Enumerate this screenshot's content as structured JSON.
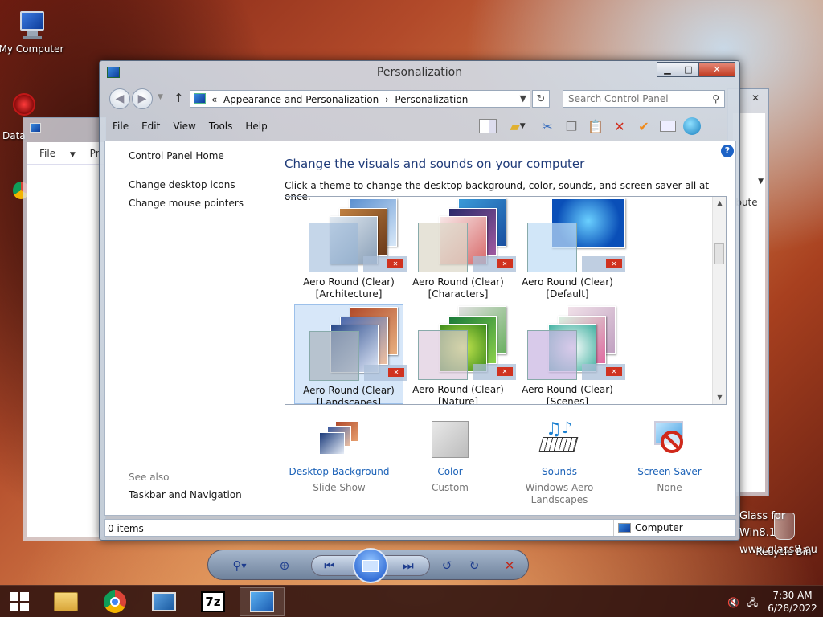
{
  "desktop": {
    "my_computer_label": "My Computer",
    "data_label": "Data",
    "watermark_line1": "Glass for Win8.1",
    "watermark_line2": "www.glass8.eu",
    "recycle_bin_label": "Recycle Bin"
  },
  "bg_window": {
    "menu_file": "File",
    "partial_label": "Pr",
    "partial_right": "ibute"
  },
  "window": {
    "title": "Personalization",
    "minimize": "▁",
    "maximize": "□",
    "close": "✕",
    "breadcrumb": {
      "prefix": "«",
      "part1": "Appearance and Personalization",
      "sep": "›",
      "part2": "Personalization"
    },
    "search_placeholder": "Search Control Panel",
    "menu": [
      "File",
      "Edit",
      "View",
      "Tools",
      "Help"
    ]
  },
  "left_pane": {
    "home": "Control Panel Home",
    "desktop_icons": "Change desktop icons",
    "mouse_pointers": "Change mouse pointers",
    "see_also": "See also",
    "taskbar_nav": "Taskbar and Navigation"
  },
  "main": {
    "heading": "Change the visuals and sounds on your computer",
    "subtext": "Click a theme to change the desktop background, color, sounds, and screen saver all at once.",
    "themes": [
      {
        "line1": "Aero Round (Clear)",
        "line2": "[Architecture]"
      },
      {
        "line1": "Aero Round (Clear)",
        "line2": "[Characters]"
      },
      {
        "line1": "Aero Round (Clear)",
        "line2": "[Default]"
      },
      {
        "line1": "Aero Round (Clear)",
        "line2": "[Landscapes]",
        "selected": true
      },
      {
        "line1": "Aero Round (Clear)",
        "line2": "[Nature]"
      },
      {
        "line1": "Aero Round (Clear)",
        "line2": "[Scenes]"
      }
    ],
    "bottom_items": [
      {
        "label": "Desktop Background",
        "sub": "Slide Show"
      },
      {
        "label": "Color",
        "sub": "Custom"
      },
      {
        "label": "Sounds",
        "sub": "Windows Aero Landscapes"
      },
      {
        "label": "Screen Saver",
        "sub": "None"
      }
    ]
  },
  "statusbar": {
    "items": "0 items",
    "location": "Computer"
  },
  "taskbar": {
    "time": "7:30 AM",
    "date": "6/28/2022",
    "sevenzip": "7z"
  },
  "colors": {
    "accent_link": "#1d63b8",
    "heading": "#1e3a78",
    "close_red": "#c0391f"
  }
}
